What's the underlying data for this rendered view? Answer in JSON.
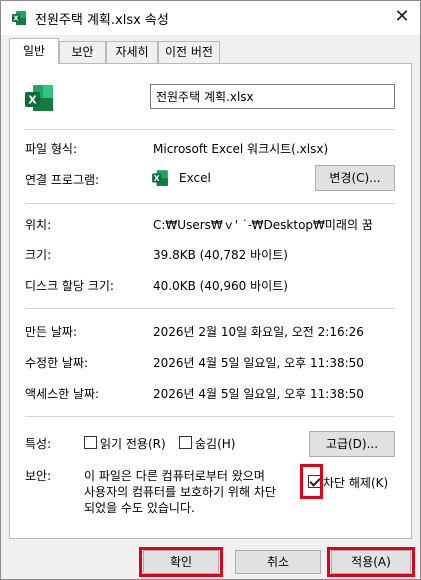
{
  "window": {
    "title": "전원주택 계획.xlsx 속성",
    "close_glyph": "✕"
  },
  "tabs": [
    {
      "label": "일반"
    },
    {
      "label": "보안"
    },
    {
      "label": "자세히"
    },
    {
      "label": "이전 버전"
    }
  ],
  "general": {
    "filename": "전원주택 계획.xlsx",
    "file_type_label": "파일 형식:",
    "file_type_value": "Microsoft Excel 워크시트(.xlsx)",
    "opens_with_label": "연결 프로그램:",
    "opens_with_value": "Excel",
    "change_button": "변경(C)...",
    "location_label": "위치:",
    "location_value": "C:₩Users₩ｖ' ˙˗₩Desktop₩미래의 꿈",
    "size_label": "크기:",
    "size_value": "39.8KB (40,782 바이트)",
    "size_on_disk_label": "디스크 할당 크기:",
    "size_on_disk_value": "40.0KB (40,960 바이트)",
    "created_label": "만든 날짜:",
    "created_value": "2026년 2월 10일 화요일, 오전 2:16:26",
    "modified_label": "수정한 날짜:",
    "modified_value": "2026년 4월 5일 일요일, 오후 11:38:50",
    "accessed_label": "액세스한 날짜:",
    "accessed_value": "2026년 4월 5일 일요일, 오후 11:38:50",
    "attributes_label": "특성:",
    "readonly_label": "읽기 전용(R)",
    "hidden_label": "숨김(H)",
    "advanced_button": "고급(D)...",
    "security_label": "보안:",
    "security_line1": "이 파일은 다른 컴퓨터로부터 왔으며",
    "security_line2": "사용자의 컴퓨터를 보호하기 위해 차단",
    "security_line3": "되었을 수도 있습니다.",
    "unblock_label": "차단 해제(K)"
  },
  "footer": {
    "ok_button": "확인",
    "cancel_button": "취소",
    "apply_button": "적용(A)"
  },
  "colors": {
    "highlight": "#e0001b",
    "excel_green": "#107c41"
  }
}
